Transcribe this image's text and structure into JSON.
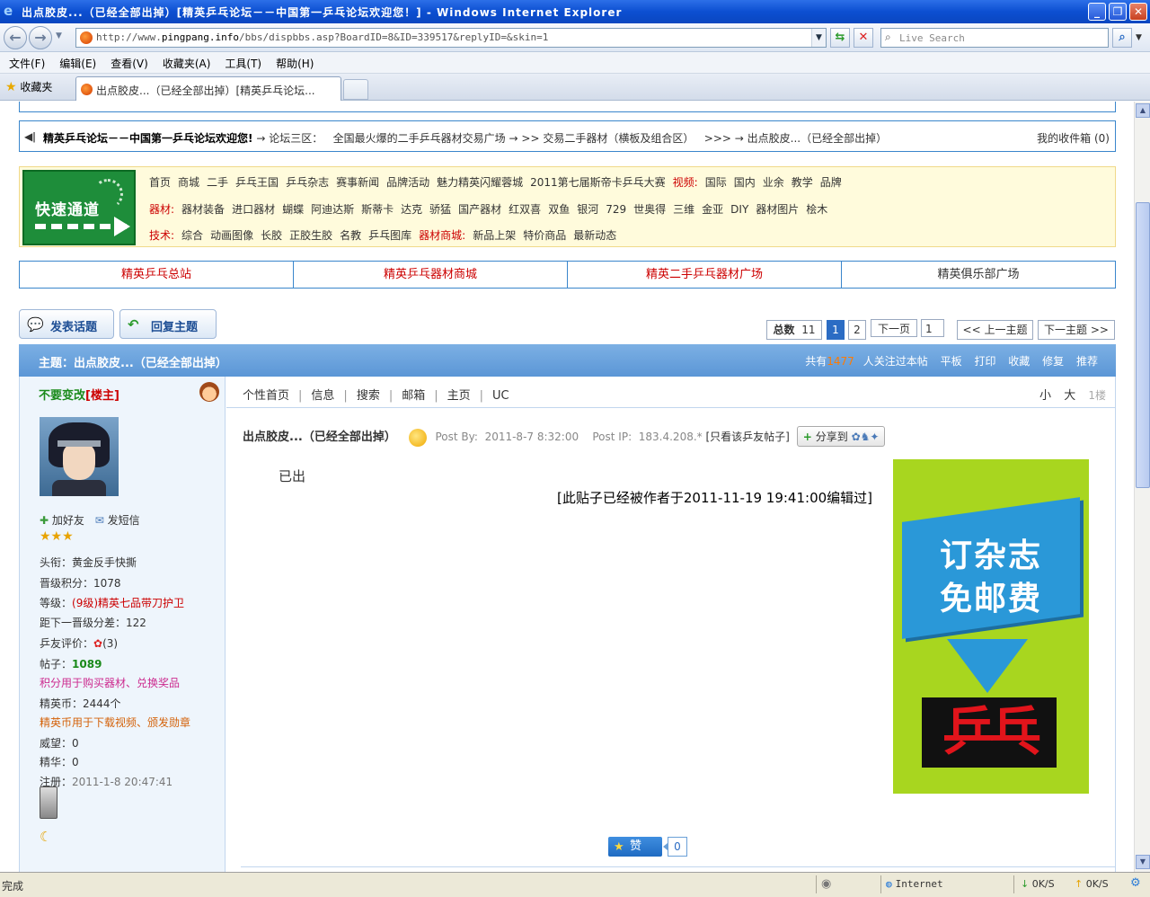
{
  "window": {
    "title": "出点胶皮...（已经全部出掉）[精英乒乓论坛－－中国第一乒乓论坛欢迎您！] - Windows Internet Explorer",
    "minimize": "_",
    "maximize": "❐",
    "close": "✕"
  },
  "address": {
    "url_prefix": "http://www.",
    "url_domain": "pingpang.info",
    "url_rest": "/bbs/dispbbs.asp?BoardID=8&ID=339517&replyID=&skin=1",
    "search_placeholder": "Live Search"
  },
  "menu": [
    "文件(F)",
    "编辑(E)",
    "查看(V)",
    "收藏夹(A)",
    "工具(T)",
    "帮助(H)"
  ],
  "tabs": {
    "favorites": "收藏夹",
    "active_tab": "出点胶皮...（已经全部出掉）[精英乒乓论坛..."
  },
  "breadcrumb": {
    "site": "精英乒乓论坛－－中国第一乒乓论坛欢迎您!",
    "sep1": "→",
    "area": "论坛三区：",
    "board": "全国最火爆的二手乒乓器材交易广场",
    "sep2": "→",
    "sub": ">> 交易二手器材（横板及组合区）",
    "sep3": ">>> →",
    "topic": "出点胶皮...（已经全部出掉）",
    "inbox": "我的收件箱 (0)"
  },
  "quicknav": {
    "logo_text": "快速通道",
    "row1": [
      "首页",
      "商城",
      "二手",
      "乒乓王国",
      "乒乓杂志",
      "赛事新闻",
      "品牌活动",
      "魅力精英闪耀蓉城",
      "2011第七届斯帝卡乒乓大赛"
    ],
    "row1_label2": "视频:",
    "row1b": [
      "国际",
      "国内",
      "业余",
      "教学",
      "品牌"
    ],
    "row2_label": "器材:",
    "row2": [
      "器材装备",
      "进口器材",
      "蝴蝶",
      "阿迪达斯",
      "斯蒂卡",
      "达克",
      "骄猛",
      "国产器材",
      "红双喜",
      "双鱼",
      "银河",
      "729",
      "世奥得",
      "三维",
      "金亚",
      "DIY",
      "器材图片",
      "桧木"
    ],
    "row3_label": "技术:",
    "row3": [
      "综合",
      "动画图像",
      "长胶",
      "正胶生胶",
      "名教",
      "乒乓图库"
    ],
    "row3_label2": "器材商城:",
    "row3b": [
      "新品上架",
      "特价商品",
      "最新动态"
    ]
  },
  "site_tabs": [
    "精英乒乓总站",
    "精英乒乓器材商城",
    "精英二手乒乓器材广场",
    "精英俱乐部广场"
  ],
  "actions": {
    "new_topic": "发表话题",
    "reply": "回复主题"
  },
  "pager": {
    "total_label": "总数",
    "total": "11",
    "page1": "1",
    "page2": "2",
    "next": "下一页",
    "jump_value": "1",
    "prev_topic": "<< 上一主题",
    "next_topic": "下一主题 >>"
  },
  "topic_bar": {
    "title": "主题：出点胶皮...（已经全部出掉）",
    "followers_prefix": "共有",
    "followers": "1477",
    "followers_suffix": "人关注过本帖",
    "tools": [
      "平板",
      "打印",
      "收藏",
      "修复",
      "推荐"
    ]
  },
  "user": {
    "name": "不要变改",
    "role": "[楼主]",
    "add_friend": "加好友",
    "message": "发短信",
    "stars": "★★★",
    "title_label": "头衔：",
    "title": "黄金反手快撕",
    "promo_label": "晋级积分：",
    "promo": "1078",
    "level_label": "等级：",
    "level": "(9级)精英七品带刀护卫",
    "next_label": "距下一晋级分差：",
    "next": "122",
    "rating_label": "乒友评价：",
    "rating": "(3)",
    "posts_label": "帖子：",
    "posts": "1089",
    "note1": "积分用于购买器材、兑换奖品",
    "coins_label": "精英币：",
    "coins": "2444个",
    "note2": "精英币用于下载视频、颁发勋章",
    "prestige_label": "威望：",
    "prestige": "0",
    "essence_label": "精华：",
    "essence": "0",
    "reg_label": "注册：",
    "reg": "2011-1-8 20:47:41"
  },
  "post": {
    "tools": [
      "个性首页",
      "信息",
      "搜索",
      "邮箱",
      "主页",
      "UC"
    ],
    "font_small": "小",
    "font_large": "大",
    "floor": "1楼",
    "title": "出点胶皮...（已经全部出掉）",
    "postby_label": "Post By:",
    "postby": "2011-8-7 8:32:00",
    "ip_label": "Post IP:",
    "ip": "183.4.208.*",
    "only_user": "[只看该乒友帖子]",
    "share": "分享到",
    "body": "已出",
    "edit_note": "[此贴子已经被作者于2011-11-19 19:41:00编辑过]",
    "like": "赞",
    "like_count": "0"
  },
  "ad": {
    "line1": "订杂志",
    "line2": "免邮费",
    "logo": "乒乓"
  },
  "status": {
    "text": "完成",
    "zone": "Internet",
    "down": "0K/S",
    "up": "0K/S"
  },
  "colors": {
    "accent_blue": "#3a86cc",
    "link_red": "#cc0000",
    "green_name": "#1a8a1a"
  }
}
